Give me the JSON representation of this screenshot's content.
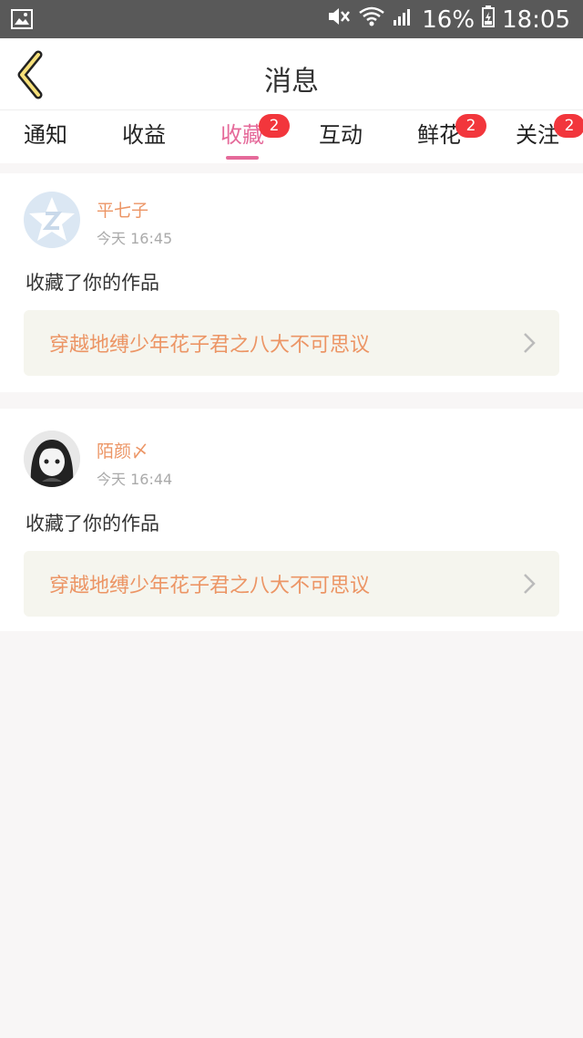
{
  "status_bar": {
    "battery": "16%",
    "time": "18:05",
    "icons": [
      "image-icon",
      "mute-icon",
      "wifi-icon",
      "signal-icon",
      "battery-icon"
    ]
  },
  "header": {
    "title": "消息",
    "back_icon": "chevron-left-icon"
  },
  "tabs": [
    {
      "label": "通知",
      "badge": ""
    },
    {
      "label": "收益",
      "badge": ""
    },
    {
      "label": "收藏",
      "badge": "2",
      "active": true
    },
    {
      "label": "互动",
      "badge": ""
    },
    {
      "label": "鲜花",
      "badge": "2"
    },
    {
      "label": "关注",
      "badge": "2"
    }
  ],
  "messages": [
    {
      "name": "平七子",
      "time": "今天 16:45",
      "action": "收藏了你的作品",
      "work_title": "穿越地缚少年花子君之八大不可思议",
      "avatar": "default-avatar-icon"
    },
    {
      "name": "陌颜〆",
      "time": "今天 16:44",
      "action": "收藏了你的作品",
      "work_title": "穿越地缚少年花子君之八大不可思议",
      "avatar": "user-avatar"
    }
  ],
  "colors": {
    "accent": "#e56a9a",
    "name": "#ec9565",
    "badge": "#f2363c",
    "work_bg": "#f5f5ee"
  }
}
